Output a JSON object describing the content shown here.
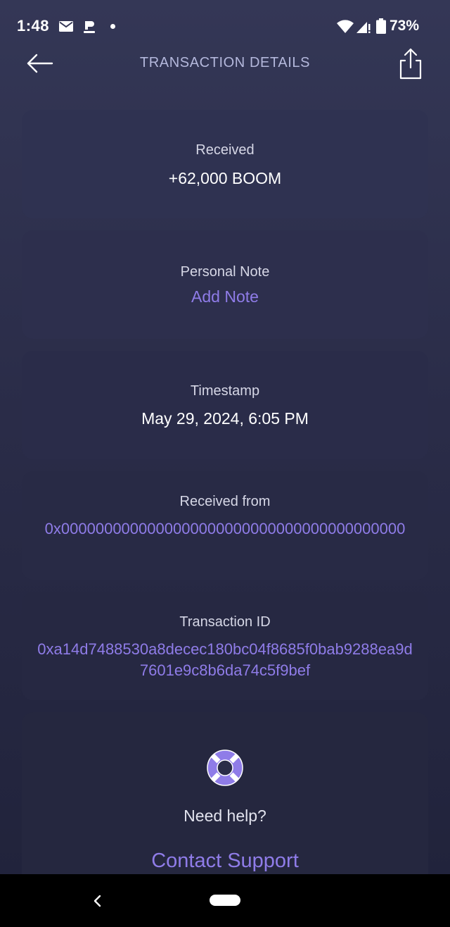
{
  "status_bar": {
    "time": "1:48",
    "battery": "73%",
    "icons": [
      "mail-icon",
      "app-notification-icon",
      "notification-dot",
      "wifi-icon",
      "signal-icon",
      "battery-icon"
    ]
  },
  "header": {
    "title": "TRANSACTION DETAILS",
    "back_icon": "arrow-left-icon",
    "share_icon": "share-icon"
  },
  "amount": {
    "label": "Received",
    "value": "+62,000 BOOM"
  },
  "note": {
    "label": "Personal Note",
    "action": "Add Note"
  },
  "timestamp": {
    "label": "Timestamp",
    "value": "May 29, 2024, 6:05 PM"
  },
  "received_from": {
    "label": "Received from",
    "address": "0x0000000000000000000000000000000000000000"
  },
  "transaction": {
    "label": "Transaction ID",
    "id": "0xa14d7488530a8decec180bc04f8685f0bab9288ea9d7601e9c8b6da74c5f9bef"
  },
  "help": {
    "icon": "lifebuoy-icon",
    "question": "Need help?",
    "action": "Contact Support"
  },
  "colors": {
    "accent": "#8f7ce8",
    "background_top": "#343756",
    "background_bottom": "#20223a",
    "card": "#2f3150",
    "title": "#b4b8dc"
  }
}
